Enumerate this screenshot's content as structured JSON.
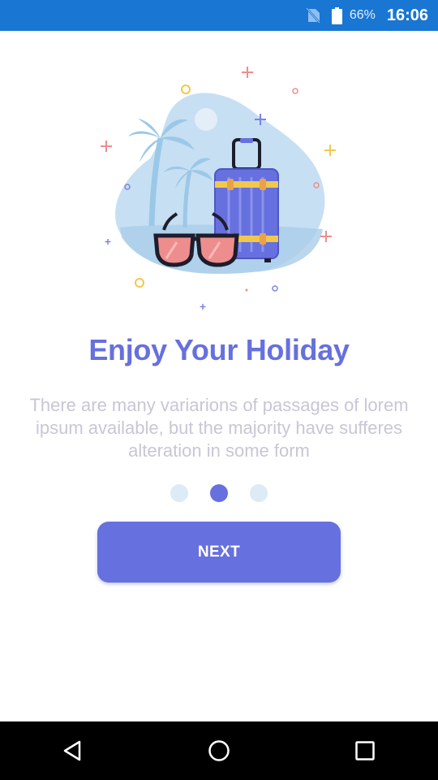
{
  "status_bar": {
    "battery_percent": "66%",
    "time": "16:06",
    "icons": [
      "no-sim-icon",
      "battery-icon"
    ]
  },
  "illustration": {
    "icon": "holiday-illustration",
    "colors": {
      "blob": "#c7dff3",
      "palm": "#9cc8e8",
      "suitcase": "#6670de",
      "suitcase_stripe": "#f2c84b",
      "lens": "#ee8d8d",
      "frame": "#1d1d2c"
    }
  },
  "onboarding": {
    "title": "Enjoy Your Holiday",
    "description_lines": [
      "There are many variarions of passages of lorem",
      "ipsum available, but the majority have sufferes",
      "alteration in some form"
    ],
    "page_indicator": {
      "total": 3,
      "current": 2
    },
    "next_label": "NEXT"
  },
  "colors": {
    "accent": "#6670de",
    "status_bar": "#1976d2",
    "inactive_dot": "#dcebf5",
    "description_text": "#c7c7d6"
  },
  "nav_bar": {
    "icons": [
      "back-icon",
      "home-icon",
      "recents-icon"
    ]
  }
}
